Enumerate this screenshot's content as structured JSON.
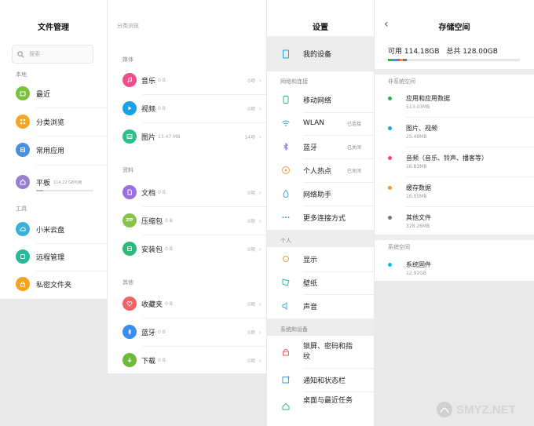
{
  "panel1": {
    "title": "文件管理",
    "search_placeholder": "搜索",
    "section_local": "本地",
    "section_tools": "工具",
    "items": [
      {
        "label": "最近",
        "color": "#7ac142"
      },
      {
        "label": "分类浏览",
        "color": "#f6a623"
      },
      {
        "label": "常用应用",
        "color": "#4a90e2"
      },
      {
        "label": "平板",
        "color": "#9b7fce",
        "sub": "114.22 GB可用"
      },
      {
        "label": "小米云盘",
        "color": "#3eafd8"
      },
      {
        "label": "远程管理",
        "color": "#26b99a"
      },
      {
        "label": "私密文件夹",
        "color": "#f7a21b"
      }
    ]
  },
  "panel2": {
    "title": "分类浏览",
    "section_media": "媒体",
    "section_docs": "资料",
    "section_other": "其他",
    "items": [
      {
        "label": "音乐",
        "sub": "0 B",
        "count": "0项",
        "color": "#f0508a"
      },
      {
        "label": "视频",
        "sub": "0 B",
        "count": "0项",
        "color": "#1aa0e8"
      },
      {
        "label": "图片",
        "sub": "13.47 MB",
        "count": "14项",
        "color": "#2cbf8a"
      },
      {
        "label": "文档",
        "sub": "0 B",
        "count": "0项",
        "color": "#9b6fe0"
      },
      {
        "label": "压缩包",
        "sub": "0 B",
        "count": "0项",
        "color": "#88c34a"
      },
      {
        "label": "安装包",
        "sub": "0 B",
        "count": "0项",
        "color": "#2eb87a"
      },
      {
        "label": "收藏夹",
        "sub": "0 B",
        "count": "0项",
        "color": "#f46262"
      },
      {
        "label": "蓝牙",
        "sub": "0 B",
        "count": "0项",
        "color": "#3a8ef0"
      },
      {
        "label": "下载",
        "sub": "0 B",
        "count": "0项",
        "color": "#6dbb3a"
      }
    ]
  },
  "panel3": {
    "title": "设置",
    "my_device": "我的设备",
    "section_network": "网络和连接",
    "section_personal": "个人",
    "section_system": "系统和设备",
    "network": [
      {
        "label": "移动网络",
        "status": "",
        "color": "#2ab79a"
      },
      {
        "label": "WLAN",
        "status": "已连接",
        "color": "#2aa7e0"
      },
      {
        "label": "蓝牙",
        "status": "已关闭",
        "color": "#8a6ee8"
      },
      {
        "label": "个人热点",
        "status": "已关闭",
        "color": "#f29a4a"
      },
      {
        "label": "网络助手",
        "status": "",
        "color": "#3aa2e8"
      },
      {
        "label": "更多连接方式",
        "status": "",
        "color": "#2a9de0"
      }
    ],
    "personal": [
      {
        "label": "显示",
        "color": "#f0a23a"
      },
      {
        "label": "壁纸",
        "color": "#2ab7a0"
      },
      {
        "label": "声音",
        "color": "#4aa8e8"
      }
    ],
    "system": [
      {
        "label": "锁屏、密码和指纹",
        "color": "#f05a5a"
      },
      {
        "label": "通知和状态栏",
        "color": "#3a9ee0"
      },
      {
        "label": "桌面与最近任务",
        "color": "#2ab790"
      }
    ]
  },
  "panel4": {
    "title": "存储空间",
    "available": "可用 114.18GB",
    "total": "总共 128.00GB",
    "section_nonsys": "非系统空间",
    "section_sys": "系统空间",
    "items": [
      {
        "label": "应用和应用数据",
        "size": "513.03MB",
        "color": "#2cb34a"
      },
      {
        "label": "图片、视频",
        "size": "25.49MB",
        "color": "#2aa0e0"
      },
      {
        "label": "音频（音乐、铃声、播客等）",
        "size": "16.83MB",
        "color": "#f04a6a"
      },
      {
        "label": "缓存数据",
        "size": "16.05MB",
        "color": "#f29a2a"
      },
      {
        "label": "其他文件",
        "size": "328.26MB",
        "color": "#777777"
      }
    ],
    "sys_item": {
      "label": "系统固件",
      "size": "12.92GB",
      "color": "#1ab8e8"
    }
  },
  "watermark": "SMYZ.NET"
}
